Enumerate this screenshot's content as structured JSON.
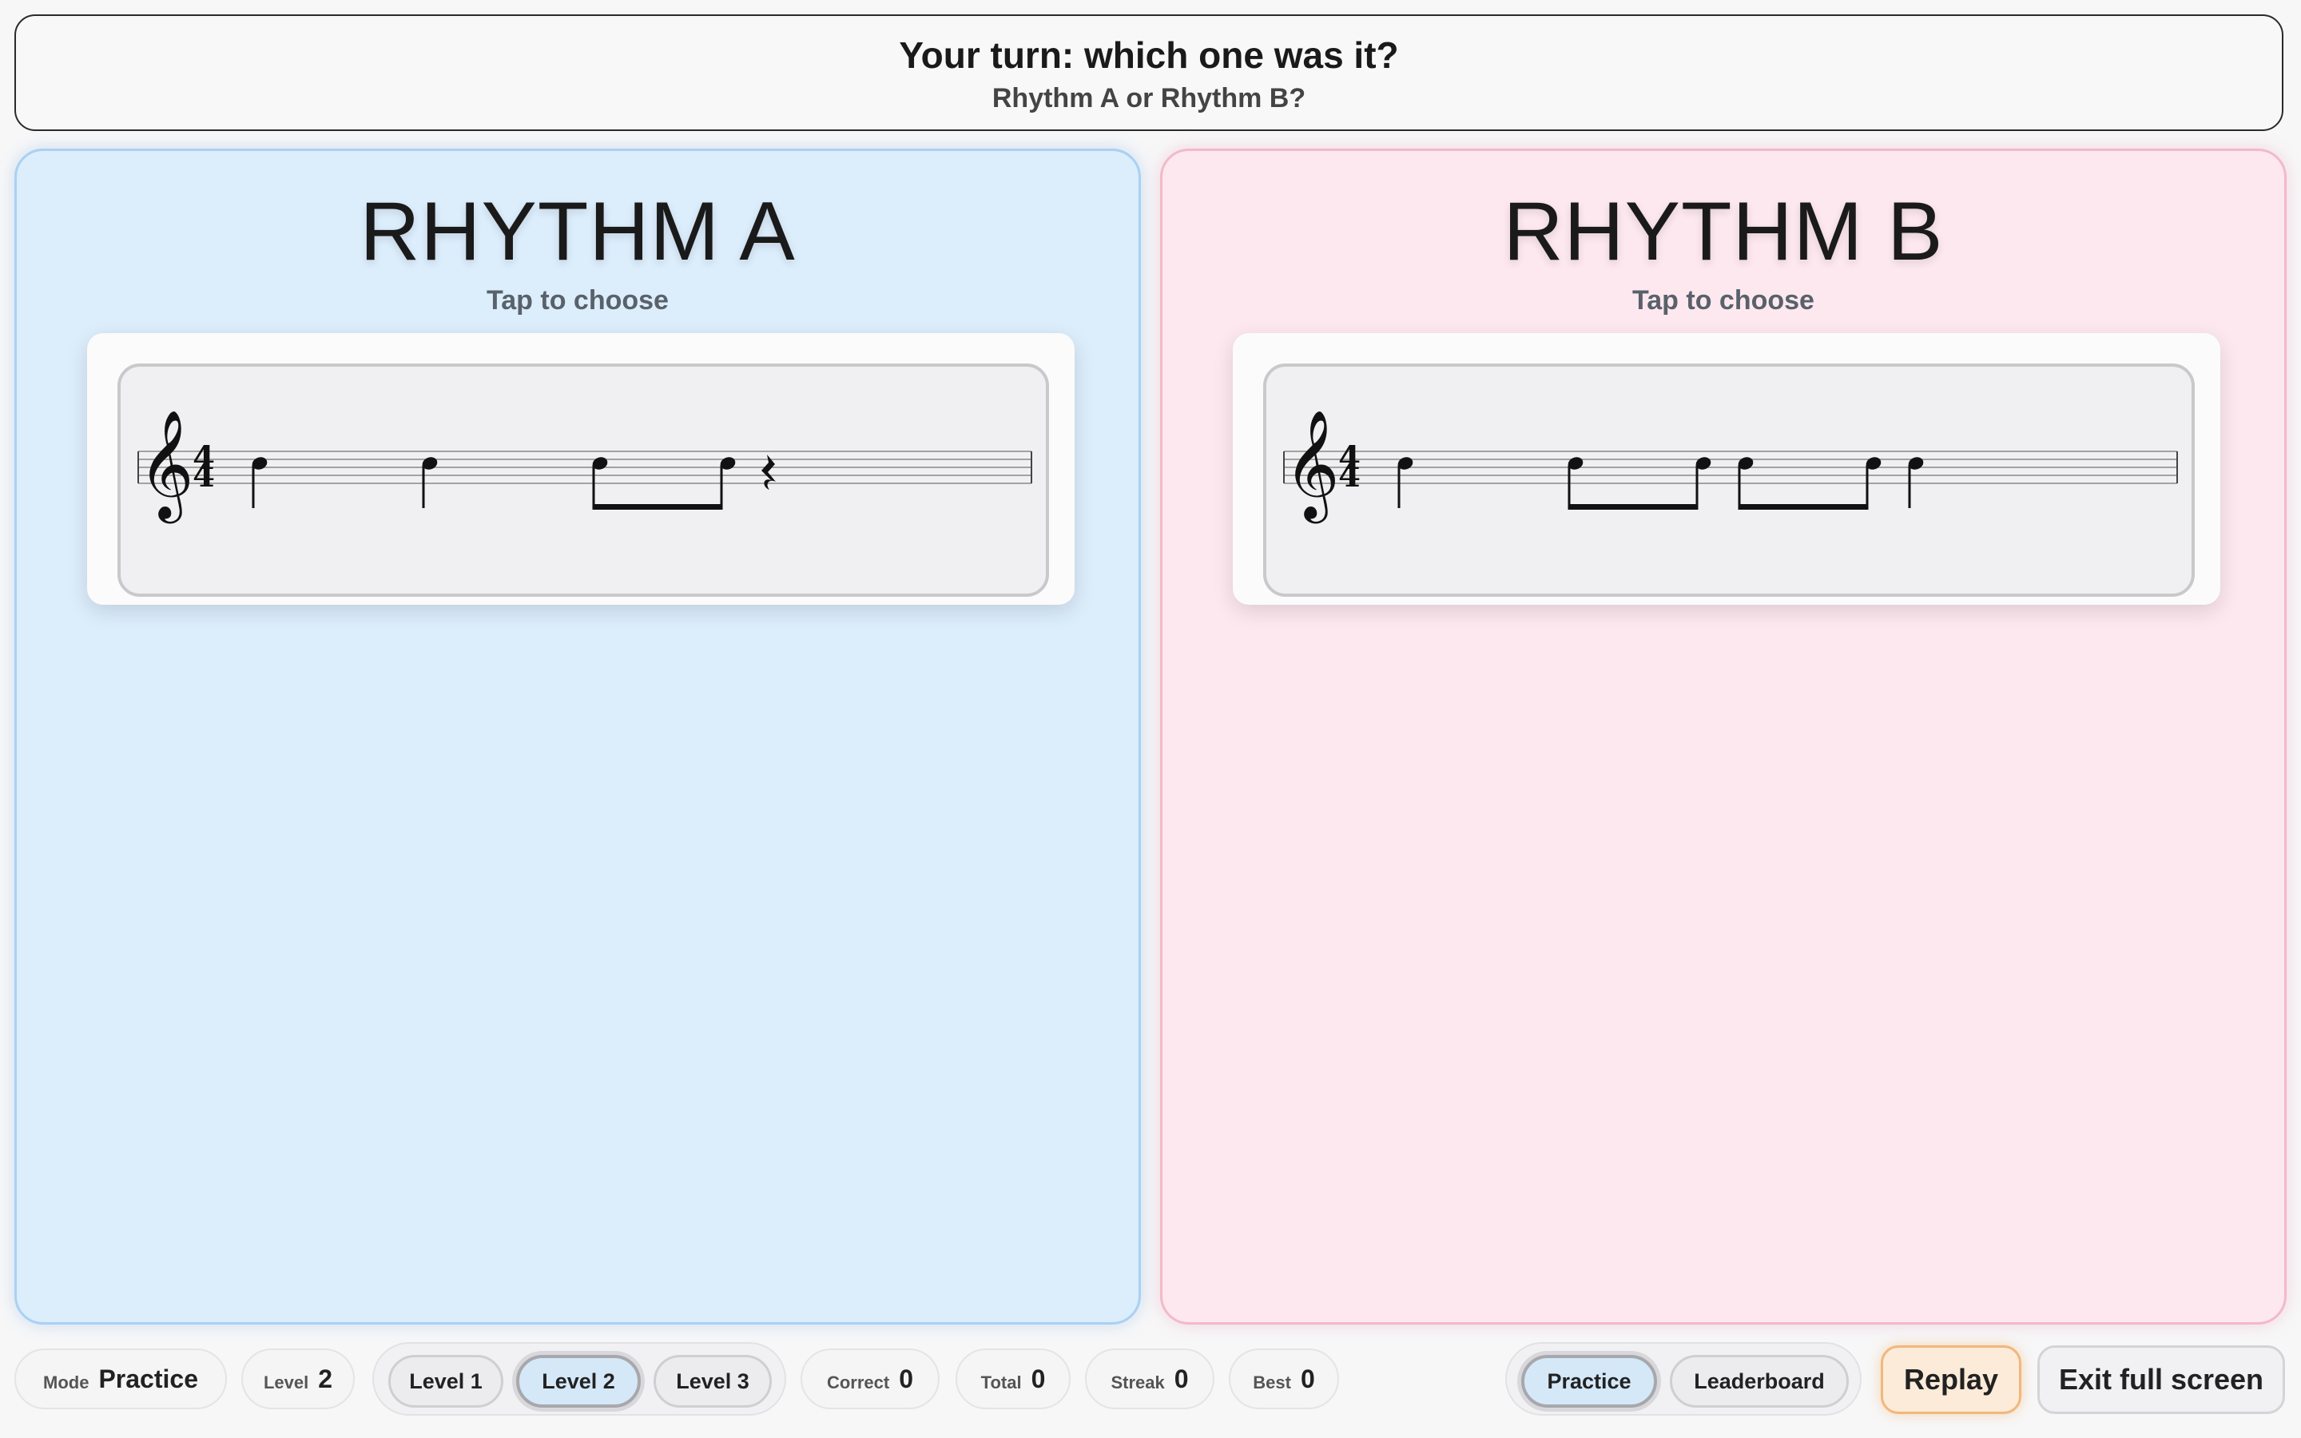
{
  "banner": {
    "title": "Your turn: which one was it?",
    "subtitle": "Rhythm A or Rhythm B?"
  },
  "panels": [
    {
      "title": "RHYTHM A",
      "subtitle": "Tap to choose",
      "time_signature": {
        "top": "4",
        "bottom": "4"
      },
      "rhythm": [
        "quarter",
        "quarter",
        "eighth-pair",
        "quarter-rest"
      ]
    },
    {
      "title": "RHYTHM B",
      "subtitle": "Tap to choose",
      "time_signature": {
        "top": "4",
        "bottom": "4"
      },
      "rhythm": [
        "quarter",
        "eighth-pair",
        "eighth-pair",
        "quarter"
      ]
    }
  ],
  "stats": {
    "mode": {
      "label": "Mode",
      "value": "Practice"
    },
    "level": {
      "label": "Level",
      "value": "2"
    },
    "correct": {
      "label": "Correct",
      "value": "0"
    },
    "total": {
      "label": "Total",
      "value": "0"
    },
    "streak": {
      "label": "Streak",
      "value": "0"
    },
    "best": {
      "label": "Best",
      "value": "0"
    }
  },
  "level_buttons": [
    "Level 1",
    "Level 2",
    "Level 3"
  ],
  "active_level": "Level 2",
  "view_buttons": [
    "Practice",
    "Leaderboard"
  ],
  "active_view": "Practice",
  "actions": {
    "replay": "Replay",
    "exit_fullscreen": "Exit full screen"
  },
  "colors": {
    "panel_a_bg": "#dcedfc",
    "panel_b_bg": "#fde8ef",
    "active_button": "#d4e8f8",
    "replay_accent": "#f1b77c"
  },
  "icons": [
    "treble-clef-icon",
    "quarter-note-icon",
    "eighth-note-pair-icon",
    "quarter-rest-icon"
  ]
}
